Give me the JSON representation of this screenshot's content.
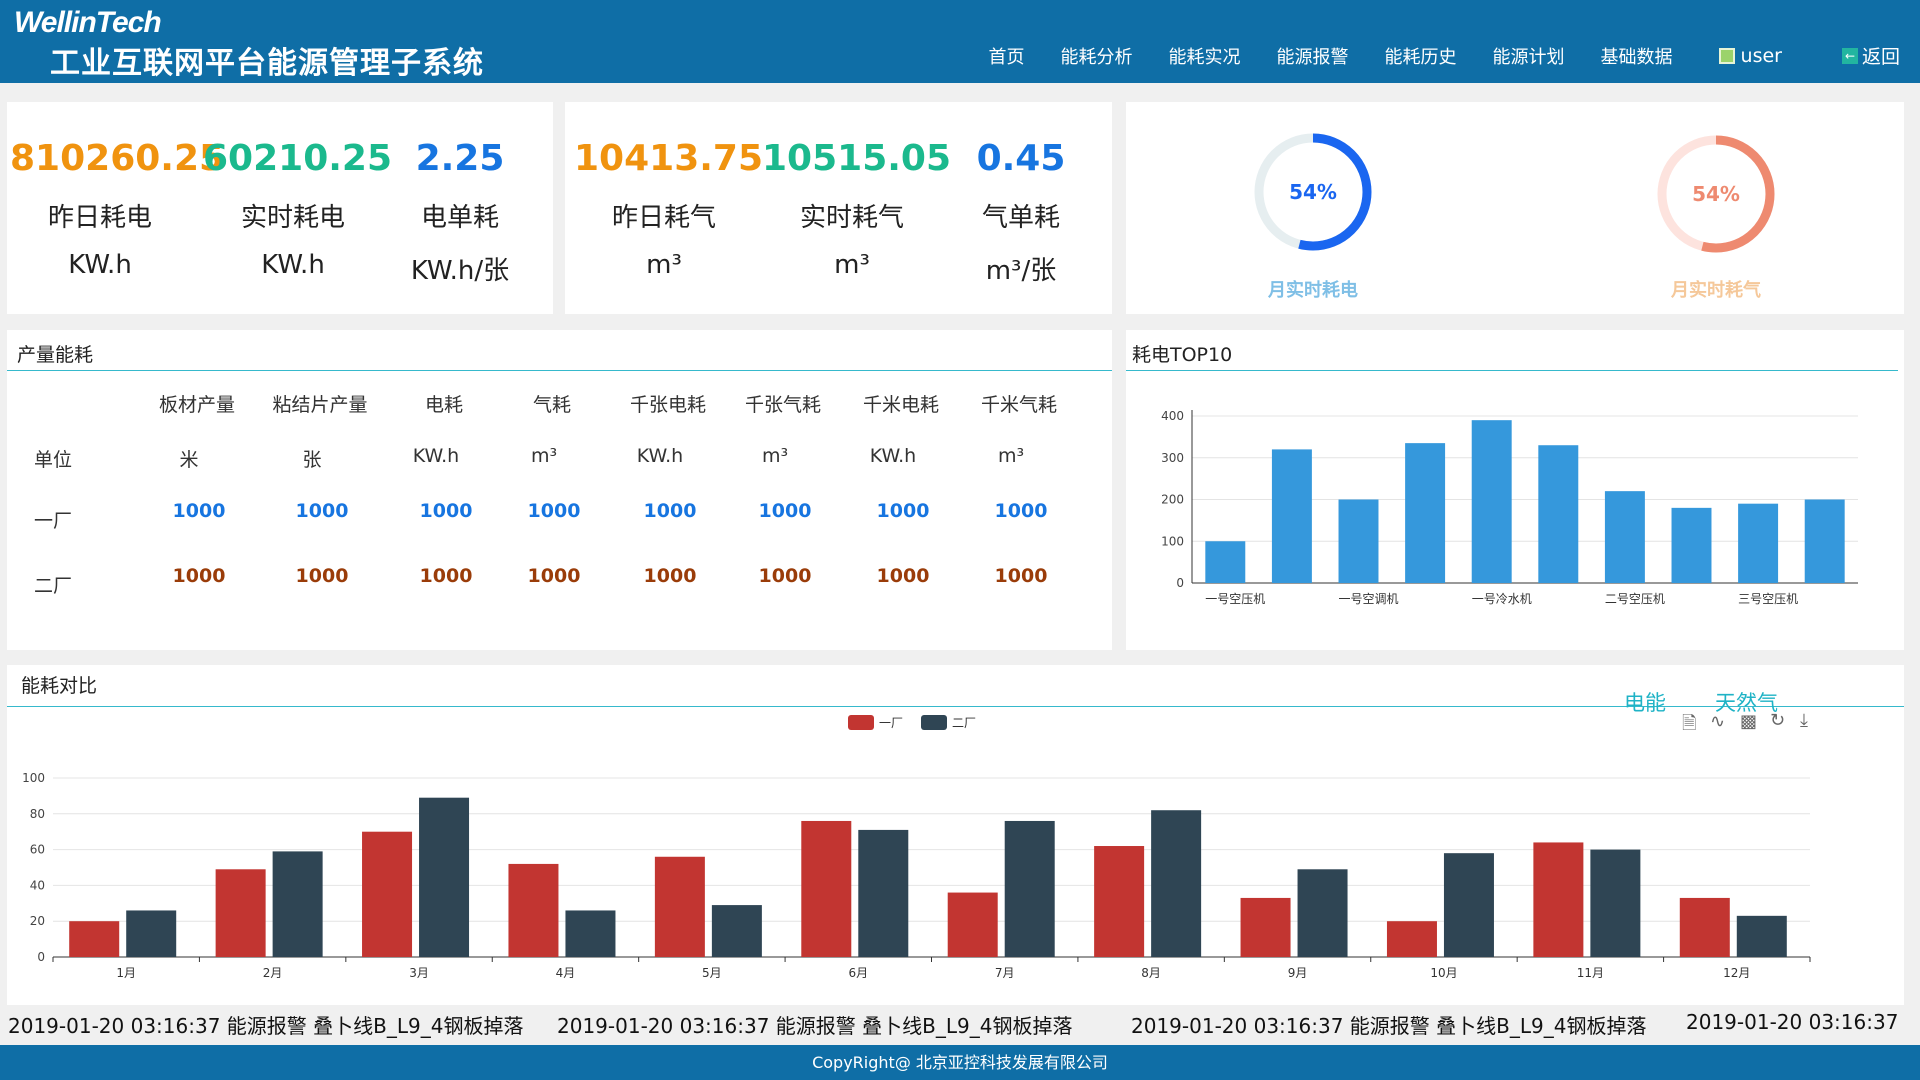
{
  "header": {
    "logo": "WellinTech",
    "title": "工业互联网平台能源管理子系统",
    "nav": [
      "首页",
      "能耗分析",
      "能耗实况",
      "能源报警",
      "能耗历史",
      "能源计划",
      "基础数据"
    ],
    "user": "user",
    "back": "返回"
  },
  "stats_power": [
    {
      "value": "810260.25",
      "label": "昨日耗电",
      "unit": "KW.h",
      "color": "#f0930f"
    },
    {
      "value": "60210.25",
      "label": "实时耗电",
      "unit": "KW.h",
      "color": "#1bb98d"
    },
    {
      "value": "2.25",
      "label": "电单耗",
      "unit": "KW.h/张",
      "color": "#1775e0"
    }
  ],
  "stats_gas": [
    {
      "value": "10413.75",
      "label": "昨日耗气",
      "unit": "m³",
      "color": "#f0930f"
    },
    {
      "value": "10515.05",
      "label": "实时耗气",
      "unit": "m³",
      "color": "#1bb98d"
    },
    {
      "value": "0.45",
      "label": "气单耗",
      "unit": "m³/张",
      "color": "#1775e0"
    }
  ],
  "rings": [
    {
      "pct": "54%",
      "value": 54,
      "label": "月实时耗电",
      "color": "#1a66f0",
      "track": "#e6eef0",
      "label_color": "#7fbfe6"
    },
    {
      "pct": "54%",
      "value": 54,
      "label": "月实时耗气",
      "color": "#ee8a70",
      "track": "#fde3de",
      "label_color": "#f5c89a"
    }
  ],
  "production": {
    "title": "产量能耗",
    "columns": [
      "板材产量",
      "粘结片产量",
      "电耗",
      "气耗",
      "千张电耗",
      "千张气耗",
      "千米电耗",
      "千米气耗"
    ],
    "unit_label": "单位",
    "units": [
      "米",
      "张",
      "KW.h",
      "m³",
      "KW.h",
      "m³",
      "KW.h",
      "m³"
    ],
    "rows": [
      {
        "name": "一厂",
        "values": [
          "1000",
          "1000",
          "1000",
          "1000",
          "1000",
          "1000",
          "1000",
          "1000"
        ]
      },
      {
        "name": "二厂",
        "values": [
          "1000",
          "1000",
          "1000",
          "1000",
          "1000",
          "1000",
          "1000",
          "1000"
        ]
      }
    ]
  },
  "top10": {
    "title": "耗电TOP10",
    "chart_data": {
      "type": "bar",
      "categories": [
        "一号空压机",
        "",
        "一号空调机",
        "",
        "一号冷水机",
        "",
        "二号空压机",
        "",
        "三号空压机",
        ""
      ],
      "values": [
        100,
        320,
        200,
        335,
        390,
        330,
        220,
        180,
        190,
        200
      ],
      "ylim": [
        0,
        400
      ],
      "yticks": [
        0,
        100,
        200,
        300,
        400
      ],
      "color": "#3598dc",
      "grid": true
    }
  },
  "compare": {
    "title": "能耗对比",
    "tabs": [
      "电能",
      "天然气"
    ],
    "toolbox": [
      "data-view-icon",
      "line-icon",
      "bar-icon",
      "refresh-icon",
      "download-icon"
    ],
    "chart_data": {
      "type": "bar",
      "categories": [
        "1月",
        "2月",
        "3月",
        "4月",
        "5月",
        "6月",
        "7月",
        "8月",
        "9月",
        "10月",
        "11月",
        "12月"
      ],
      "series": [
        {
          "name": "一厂",
          "color": "#c23531",
          "values": [
            20,
            49,
            70,
            52,
            56,
            76,
            36,
            62,
            33,
            20,
            64,
            33
          ]
        },
        {
          "name": "二厂",
          "color": "#2f4554",
          "values": [
            26,
            59,
            89,
            26,
            29,
            71,
            76,
            82,
            49,
            58,
            60,
            23
          ]
        }
      ],
      "ylim": [
        0,
        100
      ],
      "yticks": [
        0,
        20,
        40,
        60,
        80,
        100
      ],
      "legend": "top-center",
      "grid": true
    }
  },
  "ticker": [
    "2019-01-20 03:16:37  能源报警  叠卜线B_L9_4钢板掉落",
    "2019-01-20 03:16:37  能源报警  叠卜线B_L9_4钢板掉落",
    "2019-01-20 03:16:37  能源报警  叠卜线B_L9_4钢板掉落",
    "2019-01-20 03:16:37"
  ],
  "footer": "CopyRight@ 北京亚控科技发展有限公司"
}
